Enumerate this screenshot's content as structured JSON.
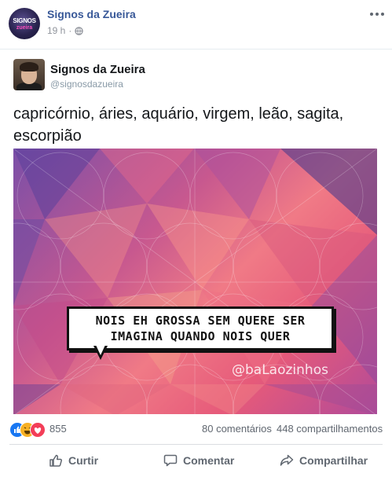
{
  "post": {
    "page_name": "Signos da Zueira",
    "time": "19 h",
    "meta_separator": "·",
    "privacy_icon": "globe-icon",
    "more_icon": "more-options-icon",
    "avatar_text": "SIGNOS",
    "avatar_text2": "zueira"
  },
  "tweet": {
    "name": "Signos da Zueira",
    "handle": "@signosdazueira",
    "text": "capricórnio, áries, aquário, virgem, leão, sagita, escorpião",
    "image": {
      "bubble_line1": "NOIS EH GROSSA SEM QUERE SER",
      "bubble_line2": "IMAGINA QUANDO NOIS QUER",
      "watermark": "@baLaozinhos"
    }
  },
  "reactions": {
    "icons": [
      "like-reaction-icon",
      "haha-reaction-icon",
      "love-reaction-icon"
    ],
    "count": "855",
    "comments": "80 comentários",
    "shares": "448 compartilhamentos"
  },
  "actions": {
    "like_label": "Curtir",
    "comment_label": "Comentar",
    "share_label": "Compartilhar"
  },
  "colors": {
    "page_name": "#385898",
    "like_blue": "#1877f2",
    "haha_yellow": "#f7b125",
    "love_red": "#f33e58",
    "muted_text": "#606770"
  }
}
